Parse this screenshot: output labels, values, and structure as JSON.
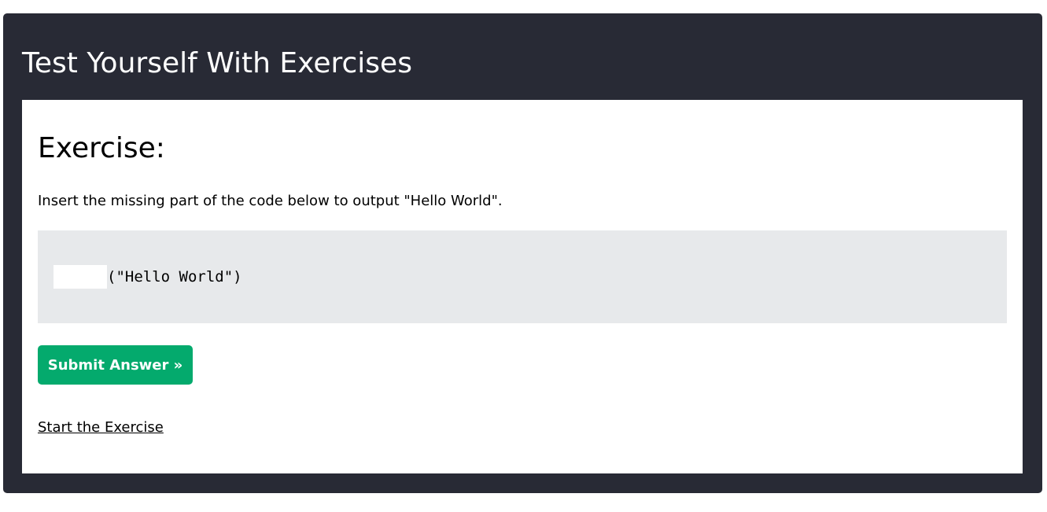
{
  "panel": {
    "title": "Test Yourself With Exercises",
    "background_color": "#282a35"
  },
  "exercise": {
    "heading": "Exercise:",
    "instructions": "Insert the missing part of the code below to output \"Hello World\".",
    "code": {
      "blank_value": "",
      "code_suffix": "(\"Hello World\")",
      "background_color": "#e7e9eb"
    },
    "submit_label": "Submit Answer »",
    "submit_color": "#04aa6d",
    "start_link_label": "Start the Exercise"
  }
}
